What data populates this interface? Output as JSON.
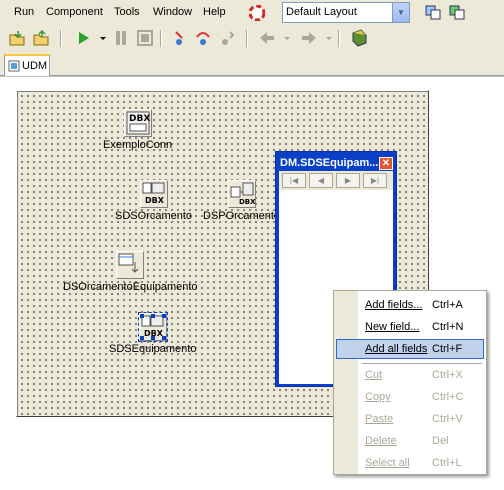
{
  "menubar": {
    "items": [
      "Run",
      "Component",
      "Tools",
      "Window",
      "Help"
    ],
    "layout_value": "Default Layout"
  },
  "tabs": [
    {
      "label": "UDM"
    }
  ],
  "components": [
    {
      "label": "ExemploConn",
      "icon": "dbx-connection-icon",
      "icon_text": "DBX"
    },
    {
      "label": "SDSOrcamento",
      "icon": "sql-dataset-icon",
      "icon_text": "DBX"
    },
    {
      "label": "DSPOrcamento",
      "icon": "dataset-provider-icon",
      "icon_text": "DBX"
    },
    {
      "label": "DSOrcamentoEquipamento",
      "icon": "datasource-icon",
      "icon_text": ""
    },
    {
      "label": "SDSEquipamento",
      "icon": "sql-dataset-icon",
      "icon_text": "DBX"
    }
  ],
  "fields_editor": {
    "title": "DM.SDSEquipam..."
  },
  "context_menu": {
    "items": [
      {
        "label": "Add fields...",
        "shortcut": "Ctrl+A",
        "enabled": true
      },
      {
        "label": "New field...",
        "shortcut": "Ctrl+N",
        "enabled": true
      },
      {
        "label": "Add all fields",
        "shortcut": "Ctrl+F",
        "enabled": true,
        "highlighted": true
      },
      {
        "label": "Cut",
        "shortcut": "Ctrl+X",
        "enabled": false
      },
      {
        "label": "Copy",
        "shortcut": "Ctrl+C",
        "enabled": false
      },
      {
        "label": "Paste",
        "shortcut": "Ctrl+V",
        "enabled": false
      },
      {
        "label": "Delete",
        "shortcut": "Del",
        "enabled": false
      },
      {
        "label": "Select all",
        "shortcut": "Ctrl+L",
        "enabled": false
      }
    ]
  },
  "colors": {
    "accent": "#0a3fc8",
    "highlight": "#c1d2ee",
    "disabled": "#aca899"
  }
}
